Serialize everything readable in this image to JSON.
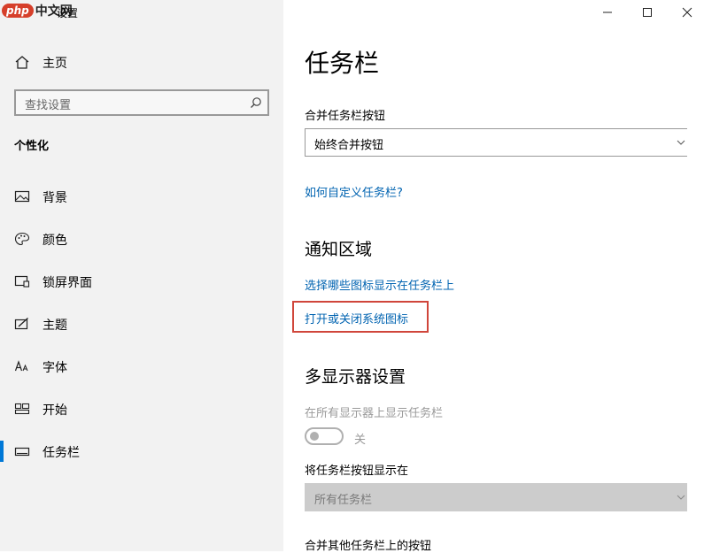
{
  "window": {
    "watermark_logo": "php",
    "watermark_text": "中文网",
    "title": "设置"
  },
  "sidebar": {
    "home_label": "主页",
    "search_placeholder": "查找设置",
    "section_title": "个性化",
    "items": [
      {
        "label": "背景",
        "icon": "picture-icon"
      },
      {
        "label": "颜色",
        "icon": "palette-icon"
      },
      {
        "label": "锁屏界面",
        "icon": "lock-screen-icon"
      },
      {
        "label": "主题",
        "icon": "theme-icon"
      },
      {
        "label": "字体",
        "icon": "font-icon"
      },
      {
        "label": "开始",
        "icon": "start-icon"
      },
      {
        "label": "任务栏",
        "icon": "taskbar-icon",
        "selected": true
      }
    ]
  },
  "main": {
    "title": "任务栏",
    "combine_label": "合并任务栏按钮",
    "combine_value": "始终合并按钮",
    "customize_link": "如何自定义任务栏?",
    "notification_title": "通知区域",
    "select_icons_link": "选择哪些图标显示在任务栏上",
    "system_icons_link": "打开或关闭系统图标",
    "multi_display_title": "多显示器设置",
    "show_on_all_label": "在所有显示器上显示任务栏",
    "toggle_state": "关",
    "show_buttons_label": "将任务栏按钮显示在",
    "show_buttons_value": "所有任务栏",
    "combine_other_label": "合并其他任务栏上的按钮"
  },
  "colors": {
    "accent": "#0078d7",
    "link": "#0063b1",
    "highlight_border": "#d0463b"
  }
}
